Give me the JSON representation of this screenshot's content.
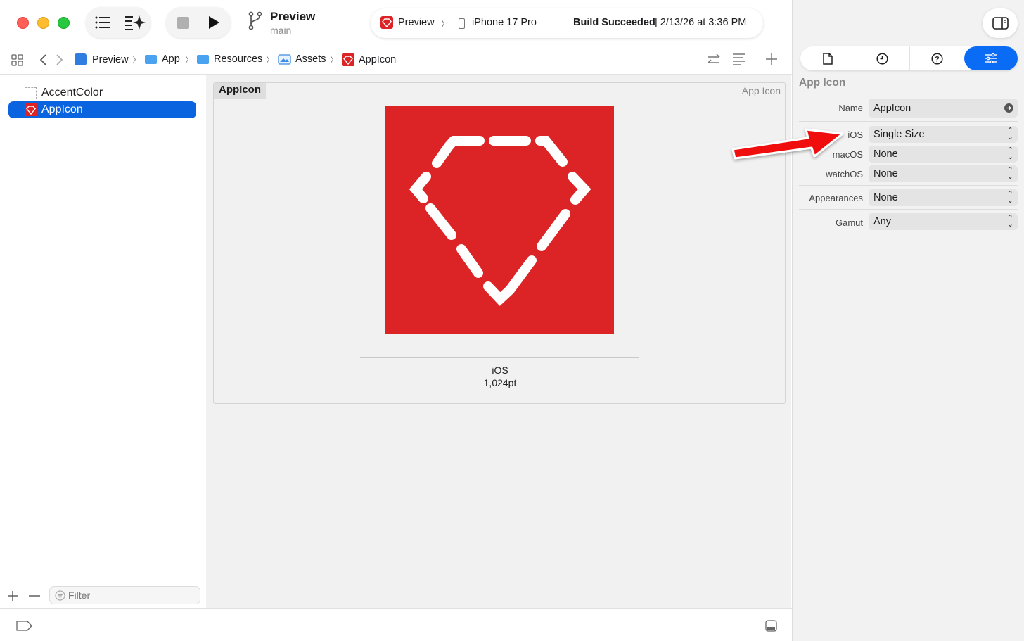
{
  "toolbar": {
    "scheme_title": "Preview",
    "scheme_branch": "main",
    "activity": {
      "scheme": "Preview",
      "device": "iPhone 17 Pro",
      "status_bold": "Build Succeeded",
      "status_rest": " | 2/13/26 at 3:36 PM"
    }
  },
  "breadcrumb": [
    "Preview",
    "App",
    "Resources",
    "Assets",
    "AppIcon"
  ],
  "navigator": {
    "items": [
      {
        "label": "AccentColor",
        "selected": false
      },
      {
        "label": "AppIcon",
        "selected": true
      }
    ],
    "filter_placeholder": "Filter"
  },
  "editor": {
    "set_name": "AppIcon",
    "set_type": "App Icon",
    "slot_platform": "iOS",
    "slot_size": "1,024pt",
    "icon_color": "#dc2426"
  },
  "inspector": {
    "section_title": "App Icon",
    "rows": [
      {
        "label": "Name",
        "value": "AppIcon"
      },
      {
        "label": "iOS",
        "value": "Single Size"
      },
      {
        "label": "macOS",
        "value": "None"
      },
      {
        "label": "watchOS",
        "value": "None"
      },
      {
        "label": "Appearances",
        "value": "None"
      },
      {
        "label": "Gamut",
        "value": "Any"
      }
    ]
  },
  "colors": {
    "accent": "#0a64e0",
    "annotation_arrow": "#f01010"
  }
}
